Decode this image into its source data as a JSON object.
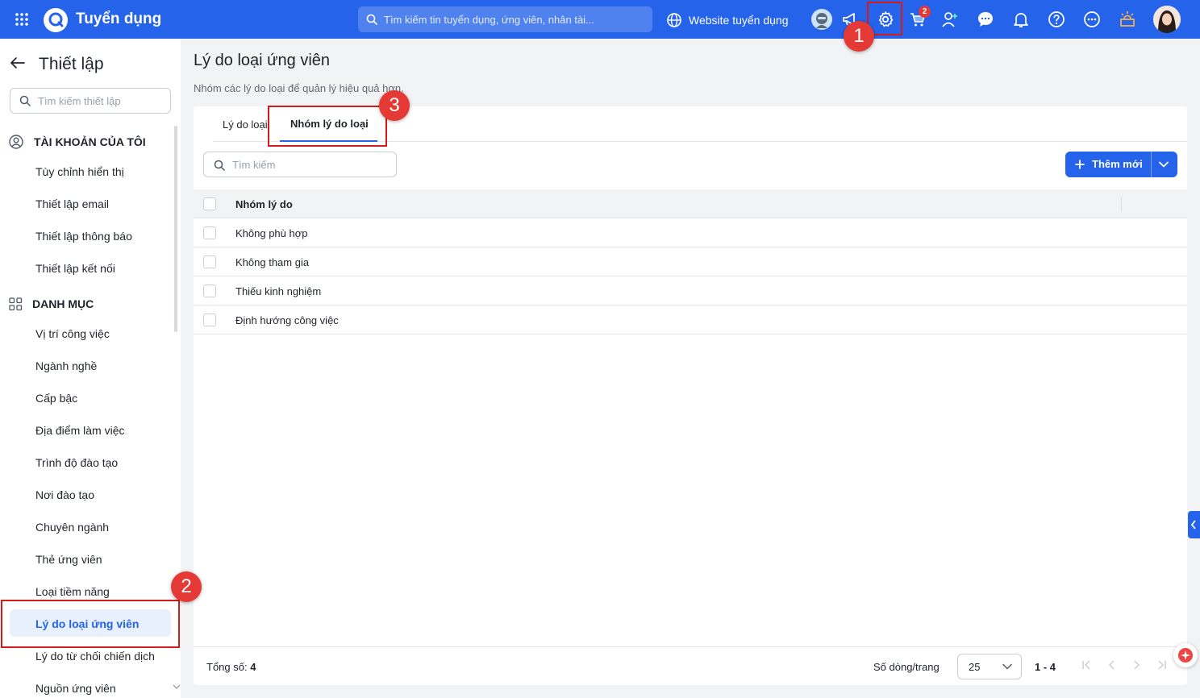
{
  "topbar": {
    "app_title": "Tuyển dụng",
    "search_placeholder": "Tìm kiếm tin tuyển dụng, ứng viên, nhân tài...",
    "website_link": "Website tuyển dụng",
    "cart_badge": "2",
    "icons": [
      "apps-grid-icon",
      "logo-icon",
      "search-icon",
      "globe-icon",
      "bot-avatar-icon",
      "megaphone-icon",
      "settings-gear-icon",
      "cart-icon",
      "add-user-icon",
      "chat-icon",
      "bell-icon",
      "help-icon",
      "more-icon",
      "lightbulb-icon",
      "user-avatar"
    ],
    "accent_color": "#2563eb"
  },
  "sidebar": {
    "title": "Thiết lập",
    "search_placeholder": "Tìm kiếm thiết lập",
    "section_account": "TÀI KHOẢN CỦA TÔI",
    "account_items": [
      "Tùy chỉnh hiển thị",
      "Thiết lập email",
      "Thiết lập thông báo",
      "Thiết lập kết nối"
    ],
    "section_category": "DANH MỤC",
    "category_items": [
      "Vị trí công việc",
      "Ngành nghề",
      "Cấp bậc",
      "Địa điểm làm việc",
      "Trình độ đào tạo",
      "Nơi đào tạo",
      "Chuyên ngành",
      "Thẻ ứng viên",
      "Loại tiềm năng",
      "Lý do loại ứng viên",
      "Lý do từ chối chiến dịch",
      "Nguồn ứng viên"
    ],
    "active_item": "Lý do loại ứng viên"
  },
  "main": {
    "title": "Lý do loại ứng viên",
    "description": "Nhóm các lý do loại để quản lý hiệu quả hơn.",
    "tabs": [
      "Lý do loại",
      "Nhóm lý do loại"
    ],
    "active_tab": "Nhóm lý do loại",
    "search_placeholder": "Tìm kiếm",
    "add_button": "Thêm mới",
    "table": {
      "header": "Nhóm lý do",
      "rows": [
        "Không phù hợp",
        "Không tham gia",
        "Thiếu kinh nghiệm",
        "Định hướng công việc"
      ]
    },
    "footer": {
      "total_label": "Tổng số:",
      "total_value": "4",
      "rows_per_page_label": "Số dòng/trang",
      "rows_per_page": "25",
      "range": "1 - 4"
    }
  },
  "annotations": [
    "1",
    "2",
    "3"
  ],
  "annotation_color": "#e53935"
}
